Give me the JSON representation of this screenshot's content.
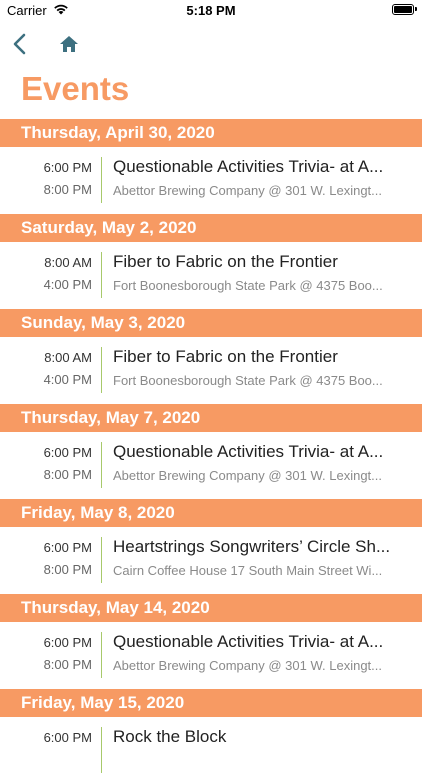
{
  "status_bar": {
    "carrier": "Carrier",
    "time": "5:18 PM",
    "icons": [
      "wifi-icon",
      "battery-icon"
    ]
  },
  "nav": {
    "back_icon": "chevron-left-icon",
    "home_icon": "home-icon",
    "accent_color": "#3d7080"
  },
  "page": {
    "title": "Events",
    "accent_color": "#f79a63"
  },
  "days": [
    {
      "date": "Thursday, April 30, 2020",
      "events": [
        {
          "start": "6:00 PM",
          "end": "8:00 PM",
          "title": "Questionable Activities Trivia- at A...",
          "location": "Abettor Brewing Company @ 301 W. Lexingt..."
        }
      ]
    },
    {
      "date": "Saturday, May 2, 2020",
      "events": [
        {
          "start": "8:00 AM",
          "end": "4:00 PM",
          "title": "Fiber to Fabric on the Frontier",
          "location": "Fort Boonesborough State Park @ 4375 Boo..."
        }
      ]
    },
    {
      "date": "Sunday, May 3, 2020",
      "events": [
        {
          "start": "8:00 AM",
          "end": "4:00 PM",
          "title": "Fiber to Fabric on the Frontier",
          "location": "Fort Boonesborough State Park @ 4375 Boo..."
        }
      ]
    },
    {
      "date": "Thursday, May 7, 2020",
      "events": [
        {
          "start": "6:00 PM",
          "end": "8:00 PM",
          "title": "Questionable Activities Trivia- at A...",
          "location": "Abettor Brewing Company @ 301 W. Lexingt..."
        }
      ]
    },
    {
      "date": "Friday, May 8, 2020",
      "events": [
        {
          "start": "6:00 PM",
          "end": "8:00 PM",
          "title": "Heartstrings Songwriters’ Circle Sh...",
          "location": "Cairn Coffee House 17 South Main Street Wi..."
        }
      ]
    },
    {
      "date": "Thursday, May 14, 2020",
      "events": [
        {
          "start": "6:00 PM",
          "end": "8:00 PM",
          "title": "Questionable Activities Trivia- at A...",
          "location": "Abettor Brewing Company @ 301 W. Lexingt..."
        }
      ]
    },
    {
      "date": "Friday, May 15, 2020",
      "events": [
        {
          "start": "6:00 PM",
          "end": "",
          "title": "Rock the Block",
          "location": ""
        }
      ]
    }
  ]
}
